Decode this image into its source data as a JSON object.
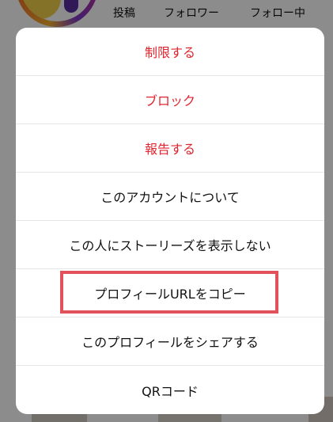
{
  "profile_stats": {
    "posts_label": "投稿",
    "followers_label": "フォロワー",
    "following_label": "フォロー中"
  },
  "action_sheet": {
    "items": [
      {
        "label": "制限する",
        "style": "destructive"
      },
      {
        "label": "ブロック",
        "style": "destructive"
      },
      {
        "label": "報告する",
        "style": "destructive"
      },
      {
        "label": "このアカウントについて",
        "style": "default"
      },
      {
        "label": "この人にストーリーズを表示しない",
        "style": "default"
      },
      {
        "label": "プロフィールURLをコピー",
        "style": "default",
        "highlighted": true
      },
      {
        "label": "このプロフィールをシェアする",
        "style": "default"
      },
      {
        "label": "QRコード",
        "style": "default"
      }
    ]
  },
  "colors": {
    "destructive": "#e0242e",
    "highlight_border": "#e2525a",
    "dim_overlay": "rgba(0,0,0,0.45)"
  }
}
